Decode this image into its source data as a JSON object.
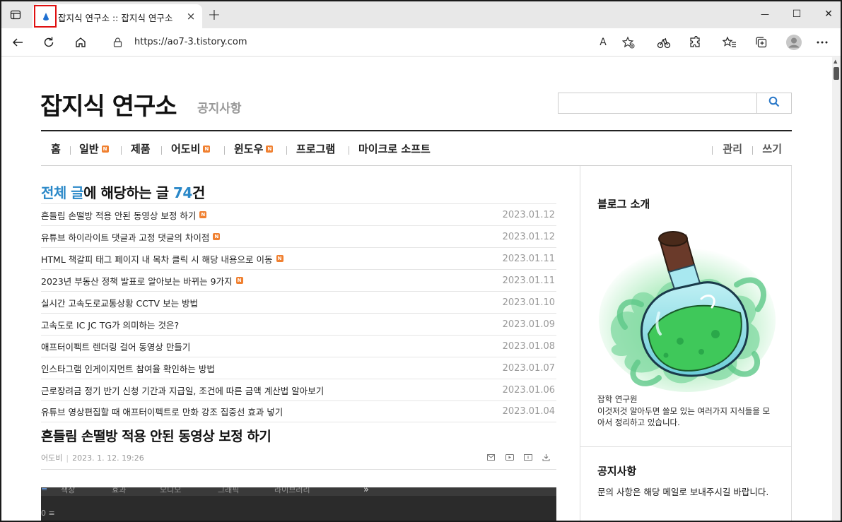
{
  "browser": {
    "tab_title": "잡지식 연구소 :: 잡지식 연구소",
    "url": "https://ao7-3.tistory.com",
    "new_tab_symbol": "+",
    "close_symbol": "×",
    "minimize_symbol": "—",
    "maximize_symbol": "☐",
    "window_close_symbol": "✕",
    "read_aloud_label": "A",
    "accent": "#e01010"
  },
  "blog": {
    "title": "잡지식 연구소",
    "subtitle": "공지사항",
    "search_placeholder": ""
  },
  "nav": {
    "items": [
      {
        "label": "홈",
        "badge": ""
      },
      {
        "label": "일반",
        "badge": "N"
      },
      {
        "label": "제품",
        "badge": ""
      },
      {
        "label": "어도비",
        "badge": "N"
      },
      {
        "label": "윈도우",
        "badge": "N"
      },
      {
        "label": "프로그램",
        "badge": ""
      },
      {
        "label": "마이크로 소프트",
        "badge": ""
      }
    ],
    "manage_label": "관리",
    "write_label": "쓰기"
  },
  "list": {
    "heading_blue": "전체 글",
    "heading_mid": "에 해당하는 글 ",
    "heading_count": "74",
    "heading_suffix": "건",
    "posts": [
      {
        "title": "흔들림 손떨방 적용 안된 동영상 보정 하기",
        "badge": "N",
        "date": "2023.01.12"
      },
      {
        "title": "유튜브 하이라이트 댓글과 고정 댓글의 차이점",
        "badge": "N",
        "date": "2023.01.12"
      },
      {
        "title": "HTML 책갈피 태그 페이지 내 목차 클릭 시 해당 내용으로 이동",
        "badge": "N",
        "date": "2023.01.11"
      },
      {
        "title": "2023년 부동산 정책 발표로 알아보는 바뀌는 9가지",
        "badge": "N",
        "date": "2023.01.11"
      },
      {
        "title": "실시간 고속도로교통상황 CCTV 보는 방법",
        "badge": "",
        "date": "2023.01.10"
      },
      {
        "title": "고속도로 IC JC TG가 의미하는 것은?",
        "badge": "",
        "date": "2023.01.09"
      },
      {
        "title": "애프터이펙트 렌더링 걸어 동영상 만들기",
        "badge": "",
        "date": "2023.01.08"
      },
      {
        "title": "인스타그램 인게이지먼트 참여율 확인하는 방법",
        "badge": "",
        "date": "2023.01.07"
      },
      {
        "title": "근로장려금 정기 반기 신청 기간과 지급일, 조건에 따른 금액 계산법 알아보기",
        "badge": "",
        "date": "2023.01.06"
      },
      {
        "title": "유튜브 영상편집할 때 애프터이펙트로 만화 강조 집중선 효과 넣기",
        "badge": "",
        "date": "2023.01.04"
      }
    ]
  },
  "article": {
    "title": "흔들림 손떨방 적용 안된 동영상 보정 하기",
    "category": "어도비",
    "datetime": "2023. 1. 12. 19:26",
    "img_menu": [
      "≡",
      "책장",
      "효과",
      "오디오",
      "그래픽",
      "라이브러리",
      "»"
    ],
    "img_row2": "0  ≡"
  },
  "sidebar": {
    "intro_title": "블로그 소개",
    "author": "잡학 연구원",
    "description": "이것저것 알아두면 쓸모 있는 여러가지 지식들을 모아서 정리하고 있습니다.",
    "notice_title": "공지사항",
    "notice_text": "문의 사항은 해당 메일로 보내주시길 바랍니다."
  }
}
